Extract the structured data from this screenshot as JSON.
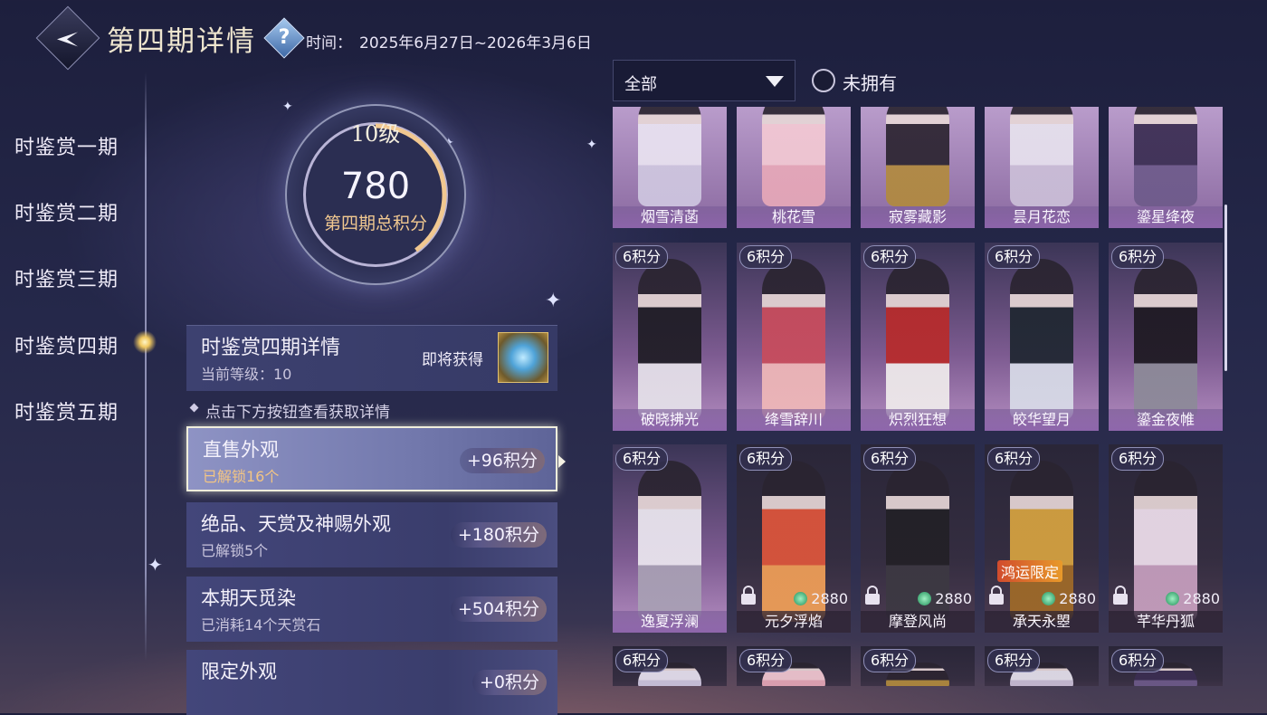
{
  "header": {
    "title": "第四期详情",
    "help_symbol": "?",
    "time_label": "时间：",
    "time_range": "2025年6月27日~2026年3月6日"
  },
  "sidebar": {
    "items": [
      {
        "label": "时鉴赏一期",
        "active": false
      },
      {
        "label": "时鉴赏二期",
        "active": false
      },
      {
        "label": "时鉴赏三期",
        "active": false
      },
      {
        "label": "时鉴赏四期",
        "active": true
      },
      {
        "label": "时鉴赏五期",
        "active": false
      }
    ]
  },
  "progress": {
    "level": "10级",
    "score": "780",
    "score_label": "第四期总积分",
    "ring_fill": 0.4
  },
  "info_card": {
    "title": "时鉴赏四期详情",
    "current_level": "当前等级：10",
    "upcoming_label": "即将获得"
  },
  "hint": "点击下方按钮查看获取详情",
  "sources": [
    {
      "title": "直售外观",
      "sub": "已解锁16个",
      "points": "+96积分",
      "selected": true
    },
    {
      "title": "绝品、天赏及神赐外观",
      "sub": "已解锁5个",
      "points": "+180积分",
      "selected": false
    },
    {
      "title": "本期天觅染",
      "sub": "已消耗14个天赏石",
      "points": "+504积分",
      "selected": false
    },
    {
      "title": "限定外观",
      "sub": "",
      "points": "+0积分",
      "selected": false
    }
  ],
  "filter": {
    "selected": "全部",
    "not_owned_label": "未拥有"
  },
  "outfits": [
    {
      "name": "烟雪清菡",
      "points": "",
      "price": "",
      "locked": false
    },
    {
      "name": "桃花雪",
      "points": "",
      "price": "",
      "locked": false
    },
    {
      "name": "寂雾藏影",
      "points": "",
      "price": "",
      "locked": false
    },
    {
      "name": "昙月花恋",
      "points": "",
      "price": "",
      "locked": false
    },
    {
      "name": "鎏星绛夜",
      "points": "",
      "price": "",
      "locked": false
    },
    {
      "name": "破晓拂光",
      "points": "6积分",
      "price": "",
      "locked": false
    },
    {
      "name": "绛雪辞川",
      "points": "6积分",
      "price": "",
      "locked": false
    },
    {
      "name": "炽烈狂想",
      "points": "6积分",
      "price": "",
      "locked": false
    },
    {
      "name": "皎华望月",
      "points": "6积分",
      "price": "",
      "locked": false
    },
    {
      "name": "鎏金夜帷",
      "points": "6积分",
      "price": "",
      "locked": false
    },
    {
      "name": "逸夏浮澜",
      "points": "6积分",
      "price": "",
      "locked": false
    },
    {
      "name": "元夕浮焰",
      "points": "6积分",
      "price": "2880",
      "locked": true
    },
    {
      "name": "摩登风尚",
      "points": "6积分",
      "price": "2880",
      "locked": true
    },
    {
      "name": "承天永曌",
      "points": "6积分",
      "price": "2880",
      "locked": true,
      "badge": "鸿运限定"
    },
    {
      "name": "芊华丹狐",
      "points": "6积分",
      "price": "2880",
      "locked": true
    },
    {
      "name": "",
      "points": "6积分",
      "price": "",
      "locked": false
    },
    {
      "name": "",
      "points": "6积分",
      "price": "",
      "locked": false
    },
    {
      "name": "",
      "points": "6积分",
      "price": "",
      "locked": false
    },
    {
      "name": "",
      "points": "6积分",
      "price": "",
      "locked": false
    },
    {
      "name": "",
      "points": "6积分",
      "price": "",
      "locked": false
    }
  ],
  "colors": {
    "gold": "#f1c890",
    "selected_row": "#7379ad",
    "panel": "#3d4170"
  }
}
